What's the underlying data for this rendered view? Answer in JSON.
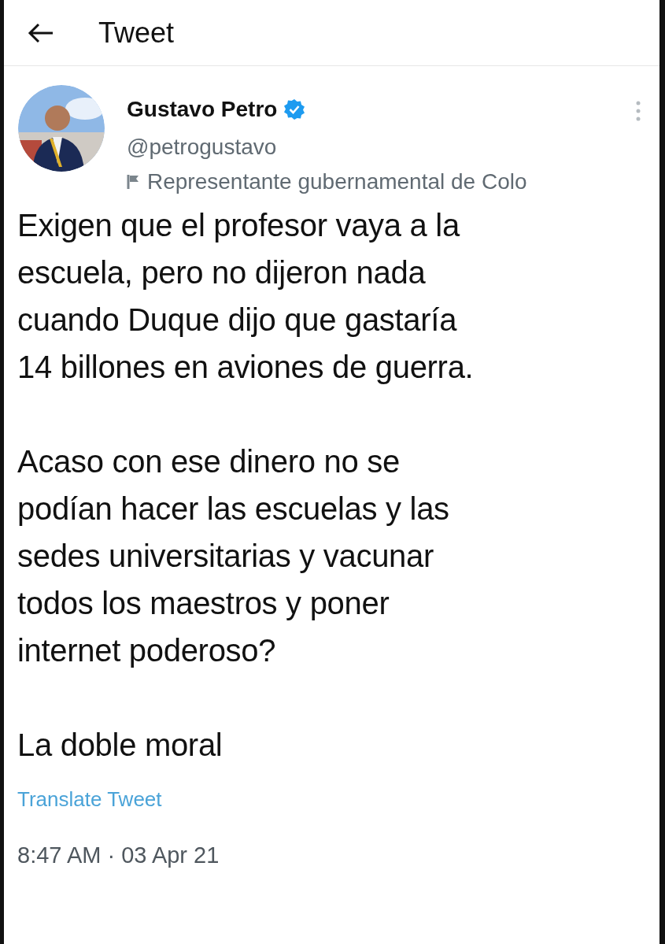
{
  "header": {
    "title": "Tweet"
  },
  "author": {
    "name": "Gustavo Petro",
    "verified": true,
    "handle": "@petrogustavo",
    "label": "Representante gubernamental de Colo"
  },
  "tweet": {
    "paragraphs": [
      "Exigen que el profesor vaya a la\nescuela, pero no dijeron nada\ncuando Duque dijo que gastaría\n14 billones en aviones de guerra.",
      "Acaso con ese dinero no se\npodían hacer las escuelas y las\nsedes universitarias y vacunar\ntodos los maestros y poner\ninternet poderoso?",
      "La doble moral"
    ],
    "translate": "Translate Tweet",
    "timestamp": "8:47 AM · 03 Apr 21"
  }
}
